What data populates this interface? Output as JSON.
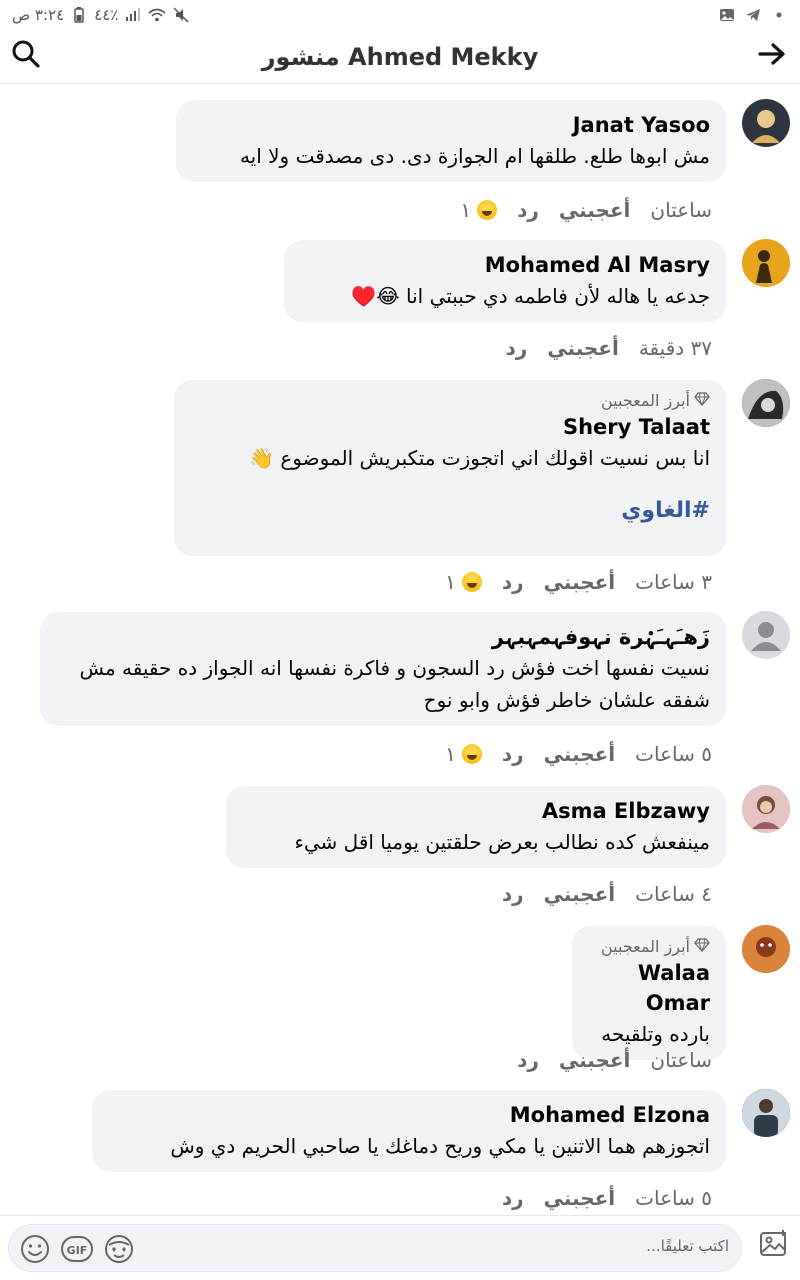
{
  "status_bar": {
    "time": "٣:٢٤ ص",
    "battery": "٤٤٪"
  },
  "header": {
    "title": "منشور Ahmed Mekky"
  },
  "comments": [
    {
      "author": "Janat Yasoo",
      "text": "مش ابوها طلع. طلقها ام الجوازة دى. دى مصدقت ولا ايه",
      "time": "ساعتان",
      "like": "أعجبني",
      "reply": "رد",
      "react_count": "١",
      "avatar_color": "#b08a4a"
    },
    {
      "author": "Mohamed Al Masry",
      "text": "جدعه يا هاله لأن فاطمه دي حببتي انا 😂♥️",
      "time": "٣٧ دقيقة",
      "like": "أعجبني",
      "reply": "رد",
      "avatar_color": "#e0a020"
    },
    {
      "top_fan": "أبرز المعجبين",
      "author": "Shery Talaat",
      "text": "انا بس نسيت اقولك اني اتجوزت متكبريش الموضوع 👋",
      "hashtag": "#الغاوي",
      "time": "٣ ساعات",
      "like": "أعجبني",
      "reply": "رد",
      "react_count": "١",
      "avatar_color": "#555555"
    },
    {
      "author": "زَهـَہـَہْرة نہوفہمہبہر",
      "text": "نسيت نفسها اخت فؤش رد السجون و فاكرة نفسها انه الجواز ده حقيقه مش شفقه علشان خاطر فؤش وابو نوح",
      "time": "٥ ساعات",
      "like": "أعجبني",
      "reply": "رد",
      "react_count": "١",
      "avatar_color": "#d8dadf"
    },
    {
      "author": "Asma Elbzawy",
      "text": "مينفعش كده نطالب بعرض حلقتين يوميا اقل شيء",
      "time": "٤ ساعات",
      "like": "أعجبني",
      "reply": "رد",
      "avatar_color": "#c79a9a"
    },
    {
      "top_fan": "أبرز المعجبين",
      "author": "Walaa Omar",
      "text": "بارده وتلقيحه",
      "time": "ساعتان",
      "like": "أعجبني",
      "reply": "رد",
      "avatar_color": "#c0703a"
    },
    {
      "author": "Mohamed Elzona",
      "text": "اتجوزهم هما الاتنين يا مكي وريح دماغك يا صاحبي الحريم دي وش",
      "time": "٥ ساعات",
      "like": "أعجبني",
      "reply": "رد",
      "avatar_color": "#3a4a5a"
    }
  ],
  "composer": {
    "placeholder": "اكتب تعليقًا..."
  },
  "icons": {
    "search": "search-icon",
    "back": "arrow-right-icon",
    "emoji": "smiley-icon",
    "gif": "gif-icon",
    "sticker": "sticker-icon",
    "photo": "photo-icon"
  }
}
